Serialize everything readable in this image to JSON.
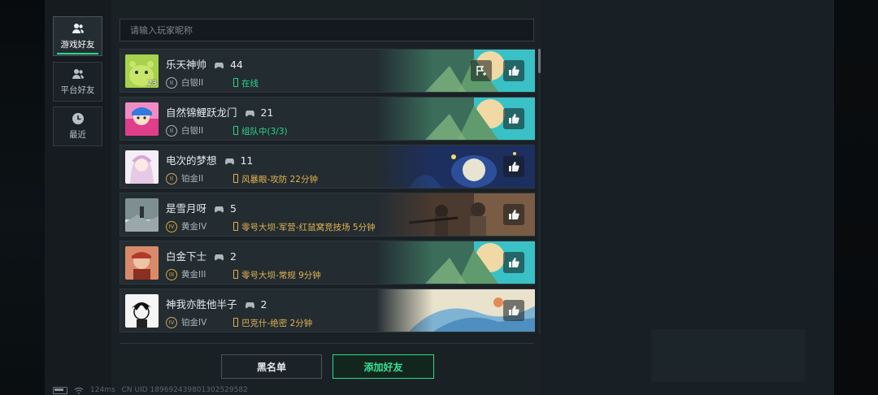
{
  "sidebar": {
    "tabs": [
      {
        "label": "游戏好友",
        "icon": "users-icon",
        "active": true
      },
      {
        "label": "平台好友",
        "icon": "users-icon",
        "active": false
      },
      {
        "label": "最近",
        "icon": "clock-icon",
        "active": false
      }
    ]
  },
  "search": {
    "placeholder": "请输入玩家昵称"
  },
  "friends": [
    {
      "name": "乐天神帅",
      "count": "44",
      "rank": "白银II",
      "status": "在线",
      "status_type": "online",
      "avatar_level": "23"
    },
    {
      "name": "自然锦鲤跃龙门",
      "count": "21",
      "rank": "白银II",
      "status": "组队中(3/3)",
      "status_type": "team"
    },
    {
      "name": "电次的梦想",
      "count": "11",
      "rank": "铂金II",
      "status": "风暴眼-攻防 22分钟",
      "status_type": "game"
    },
    {
      "name": "是雪月呀",
      "count": "5",
      "rank": "黄金IV",
      "status": "零号大坝-军营-红鼠窝竞技场 5分钟",
      "status_type": "game"
    },
    {
      "name": "白金下士",
      "count": "2",
      "rank": "黄金III",
      "status": "零号大坝-常规 9分钟",
      "status_type": "game"
    },
    {
      "name": "神我亦胜他半子",
      "count": "2",
      "rank": "铂金IV",
      "status": "巴克什-绝密 2分钟",
      "status_type": "game"
    }
  ],
  "buttons": {
    "blacklist": "黑名单",
    "add_friend": "添加好友"
  },
  "footer": {
    "ping": "124ms",
    "uid": "CN UID 18969243980130252958​2"
  },
  "colors": {
    "accent": "#2bd98c",
    "in_game": "#e2b352",
    "panel": "#1a2125"
  }
}
